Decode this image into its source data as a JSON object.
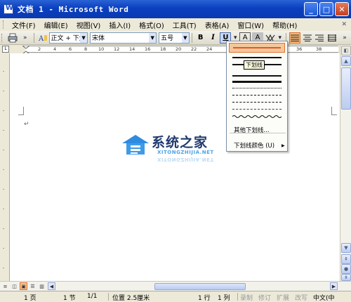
{
  "window": {
    "title": "文档 1 - Microsoft Word",
    "minimize": "_",
    "maximize": "□",
    "close": "✕"
  },
  "menubar": {
    "items": [
      "文件(F)",
      "编辑(E)",
      "视图(V)",
      "插入(I)",
      "格式(O)",
      "工具(T)",
      "表格(A)",
      "窗口(W)",
      "帮助(H)"
    ]
  },
  "toolbar": {
    "style_value": "正文 + 下划",
    "font_value": "宋体",
    "size_value": "五号",
    "bold": "B",
    "italic": "I",
    "underline": "U",
    "char_border": "A",
    "char_shading": "A"
  },
  "ruler": {
    "numbers": [
      "2",
      "4",
      "6",
      "8",
      "10",
      "12",
      "14",
      "16",
      "18",
      "20",
      "22",
      "24",
      "36",
      "38"
    ]
  },
  "underline_menu": {
    "tooltip": "下划线",
    "more": "其他下划线...",
    "color": "下划线颜色 (U)"
  },
  "document": {
    "paragraph_mark": "↵"
  },
  "watermark": {
    "cn": "系统之家",
    "en": "XITONGZHIJIA.NET"
  },
  "statusbar": {
    "page": "1 页",
    "section": "1 节",
    "page_of": "1/1",
    "position": "位置 2.5厘米",
    "line": "1 行",
    "column": "1 列",
    "rec": "录制",
    "trk": "修订",
    "ext": "扩展",
    "ovr": "改写",
    "lang": "中文(中"
  },
  "colors": {
    "titlebar": "#0a3fbf",
    "highlight_orange": "#f4c79a",
    "underline_sample": "#e2592a"
  }
}
